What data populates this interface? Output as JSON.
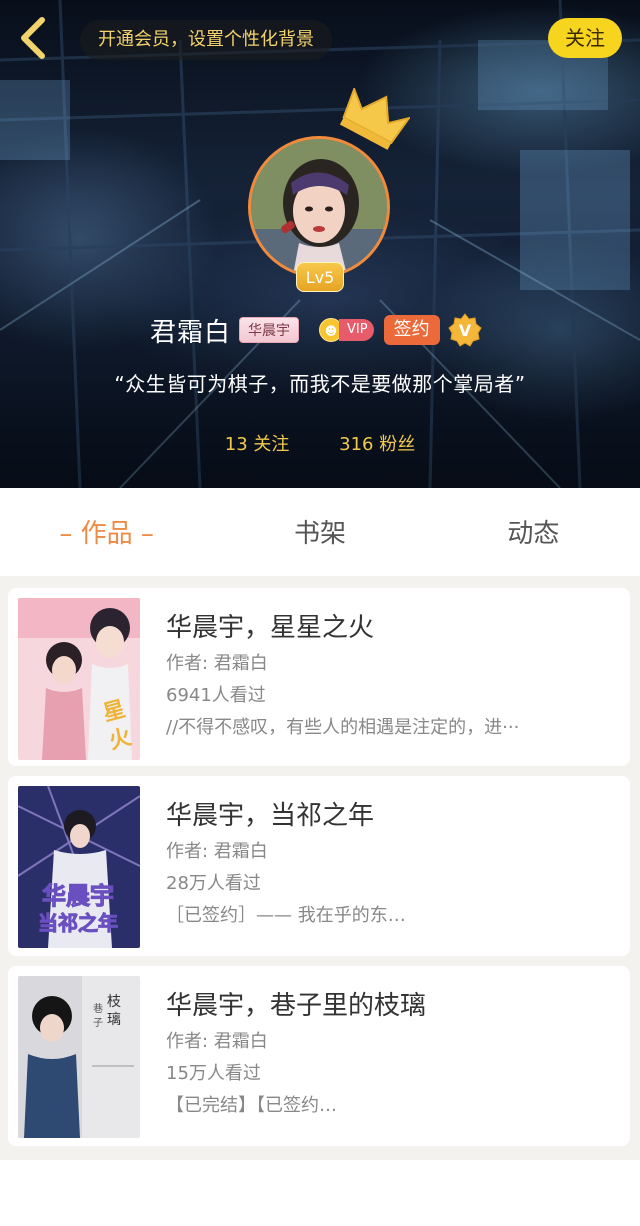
{
  "header": {
    "vip_prompt": "开通会员，设置个性化背景",
    "follow_label": "关注",
    "level": "Lv5",
    "user_name": "君霜白",
    "fan_tag": "华晨宇",
    "vip_label": "VIP",
    "signed_label": "签约",
    "verified_label": "V",
    "motto": "“众生皆可为棋子，而我不是要做那个掌局者”",
    "following": "13 关注",
    "followers": "316 粉丝"
  },
  "tabs": [
    {
      "label": "– 作品 –",
      "active": true
    },
    {
      "label": "书架",
      "active": false
    },
    {
      "label": "动态",
      "active": false
    }
  ],
  "books": [
    {
      "title": "华晨宇，星星之火",
      "author": "作者: 君霜白",
      "views": "6941人看过",
      "desc": "//不得不感叹，有些人的相遇是注定的，进···"
    },
    {
      "title": "华晨宇，当祁之年",
      "author": "作者: 君霜白",
      "views": "28万人看过",
      "desc": "［已签约］—— 我在乎的东…"
    },
    {
      "title": "华晨宇，巷子里的枝璃",
      "author": "作者: 君霜白",
      "views": "15万人看过",
      "desc": "【已完结】【已签约…"
    }
  ],
  "colors": {
    "accent_orange": "#ef8a45",
    "follow_yellow": "#f7d51e",
    "stats_gold": "#f2c94c"
  },
  "icons": [
    "back-chevron-icon",
    "crown-icon",
    "vip-coin-icon",
    "verified-v-icon"
  ]
}
